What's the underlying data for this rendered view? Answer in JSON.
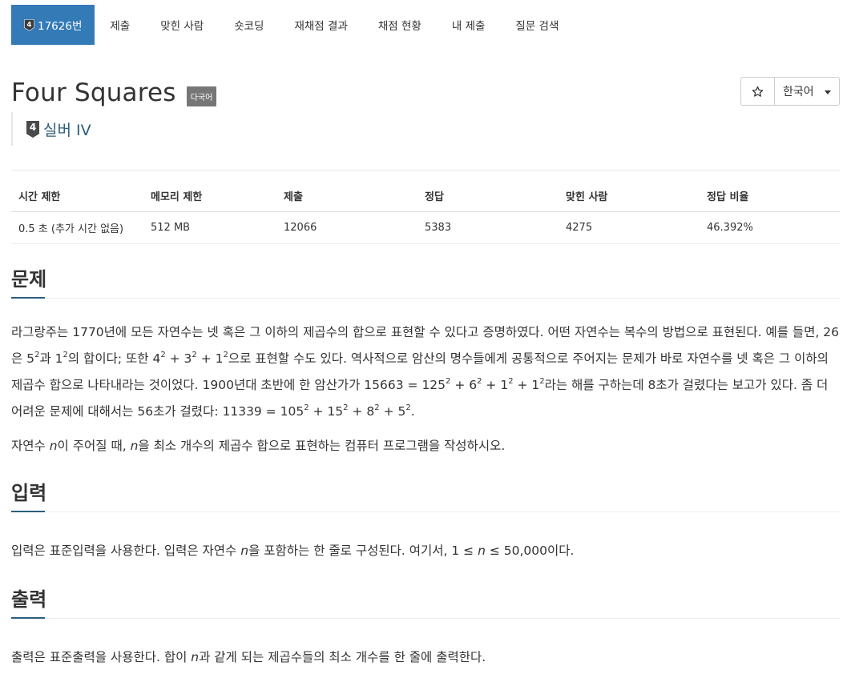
{
  "tabs": [
    {
      "label": "17626번",
      "active": true,
      "badge": "4"
    },
    {
      "label": "제출"
    },
    {
      "label": "맞힌 사람"
    },
    {
      "label": "숏코딩"
    },
    {
      "label": "재채점 결과"
    },
    {
      "label": "채점 현황"
    },
    {
      "label": "내 제출"
    },
    {
      "label": "질문 검색"
    }
  ],
  "problem": {
    "title": "Four Squares",
    "badge": "다국어",
    "tier_level": "4",
    "tier": "실버 IV",
    "language": "한국어",
    "star_icon": "star-icon"
  },
  "info": {
    "headers": [
      "시간 제한",
      "메모리 제한",
      "제출",
      "정답",
      "맞힌 사람",
      "정답 비율"
    ],
    "values": [
      "0.5 초 (추가 시간 없음)",
      "512 MB",
      "12066",
      "5383",
      "4275",
      "46.392%"
    ]
  },
  "sections": {
    "problem_title": "문제",
    "input_title": "입력",
    "output_title": "출력",
    "desc": {
      "t1": "라그랑주는 1770년에 모든 자연수는 넷 혹은 그 이하의 제곱수의 합으로 표현할 수 있다고 증명하였다. 어떤 자연수는 복수의 방법으로 표현된다. 예를 들면, 26은 5",
      "t2": "과 1",
      "t3": "의 합이다; 또한 4",
      "t4": " + 3",
      "t5": " + 1",
      "t6": "으로 표현할 수도 있다. 역사적으로 암산의 명수들에게 공통적으로 주어지는 문제가 바로 자연수를 넷 혹은 그 이하의 제곱수 합으로 나타내라는 것이었다. 1900년대 초반에 한 암산가가 15663 = 125",
      "t7": " + 6",
      "t8": " + 1",
      "t9": " + 1",
      "t10": "라는 해를 구하는데 8초가 걸렸다는 보고가 있다. 좀 더 어려운 문제에 대해서는 56초가 걸렸다: 11339 = 105",
      "t11": " + 15",
      "t12": " + 8",
      "t13": " + 5",
      "t14": ".",
      "sup": "2",
      "p2a": "자연수 ",
      "n": "n",
      "p2b": "이 주어질 때, ",
      "p2c": "을 최소 개수의 제곱수 합으로 표현하는 컴퓨터 프로그램을 작성하시오."
    },
    "input": {
      "a": "입력은 표준입력을 사용한다. 입력은 자연수 ",
      "b": "을 포함하는 한 줄로 구성된다. 여기서, 1 ≤ ",
      "c": " ≤ 50,000이다."
    },
    "output": {
      "a": "출력은 표준출력을 사용한다. 합이 ",
      "b": "과 같게 되는 제곱수들의 최소 개수를 한 줄에 출력한다."
    }
  },
  "colors": {
    "accent": "#337ab7",
    "tier": "#2c5e7e",
    "badge": "#777777"
  }
}
